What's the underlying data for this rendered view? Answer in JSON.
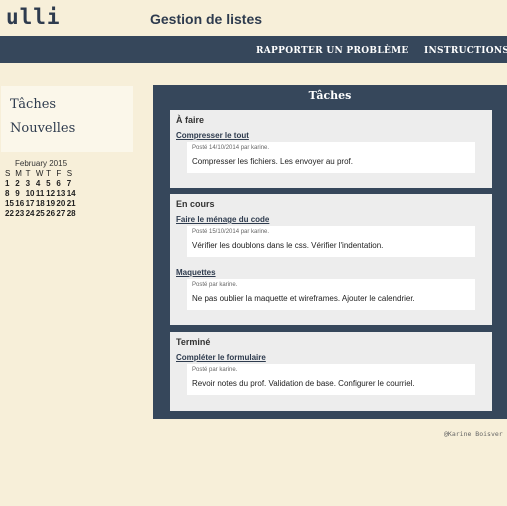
{
  "header": {
    "logo": "ulli",
    "title": "Gestion de listes"
  },
  "nav": {
    "report": "RAPPORTER UN PROBLÈME",
    "instructions": "INSTRUCTIONS"
  },
  "sidebar": {
    "items": [
      {
        "label": "Tâches"
      },
      {
        "label": "Nouvelles"
      }
    ]
  },
  "calendar": {
    "title": "February 2015",
    "weekdays": [
      "S",
      "M",
      "T",
      "W",
      "T",
      "F",
      "S"
    ],
    "weeks": [
      [
        "1",
        "2",
        "3",
        "4",
        "5",
        "6",
        "7"
      ],
      [
        "8",
        "9",
        "10",
        "11",
        "12",
        "13",
        "14"
      ],
      [
        "15",
        "16",
        "17",
        "18",
        "19",
        "20",
        "21"
      ],
      [
        "22",
        "23",
        "24",
        "25",
        "26",
        "27",
        "28"
      ]
    ]
  },
  "main": {
    "title": "Tâches",
    "sections": [
      {
        "title": "À faire",
        "tasks": [
          {
            "title": "Compresser le tout",
            "meta": "Posté 14/10/2014 par karine.",
            "body": "Compresser les fichiers. Les envoyer au prof."
          }
        ]
      },
      {
        "title": "En cours",
        "tasks": [
          {
            "title": "Faire le ménage du code",
            "meta": "Posté 15/10/2014 par karine.",
            "body": "Vérifier les doublons dans le css. Vérifier l'indentation."
          },
          {
            "title": "Maquettes",
            "meta": "Posté par karine.",
            "body": "Ne pas oublier la maquette et wireframes. Ajouter le calendrier."
          }
        ]
      },
      {
        "title": "Terminé",
        "tasks": [
          {
            "title": "Compléter le formulaire",
            "meta": "Posté par karine.",
            "body": "Revoir notes du prof. Validation de base. Configurer le courriel."
          }
        ]
      }
    ]
  },
  "footer": {
    "credit": "@Karine Boisver"
  }
}
